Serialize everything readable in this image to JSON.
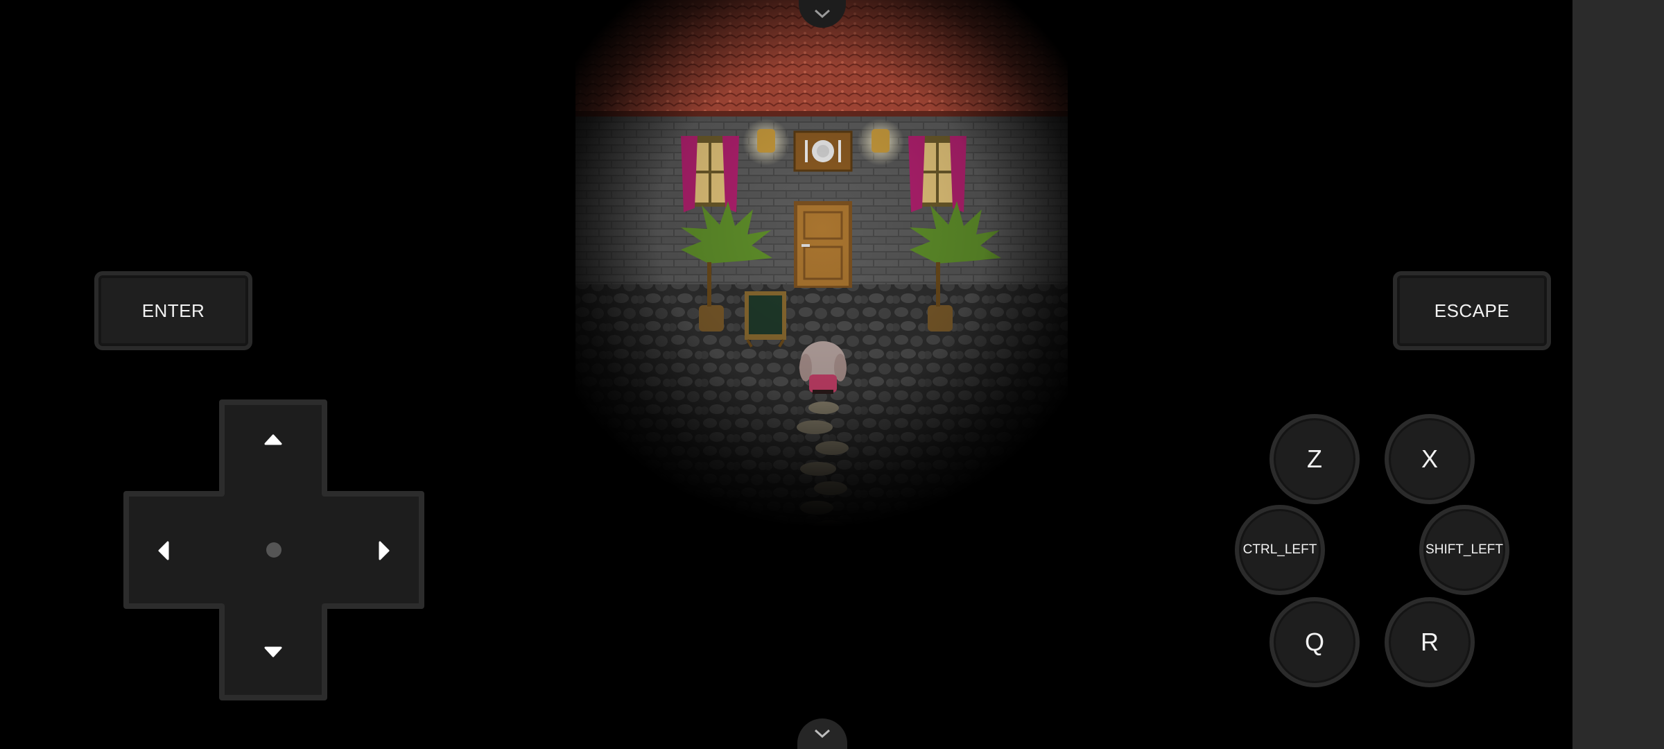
{
  "controls": {
    "enter_label": "ENTER",
    "escape_label": "ESCAPE",
    "z_label": "Z",
    "x_label": "X",
    "ctrl_left_label": "CTRL_LEFT",
    "shift_left_label": "SHIFT_LEFT",
    "q_label": "Q",
    "r_label": "R"
  },
  "icons": {
    "top": "chevron-down-icon",
    "bottom": "chevron-down-icon",
    "dpad_up": "triangle-up-icon",
    "dpad_down": "triangle-down-icon",
    "dpad_left": "triangle-left-icon",
    "dpad_right": "triangle-right-icon"
  },
  "colors": {
    "background": "#000000",
    "button_fill": "#1f1f1f",
    "button_border": "#2a2a2a",
    "roof": "#b5503e",
    "door": "#a8742f",
    "curtain": "#b0206e"
  }
}
